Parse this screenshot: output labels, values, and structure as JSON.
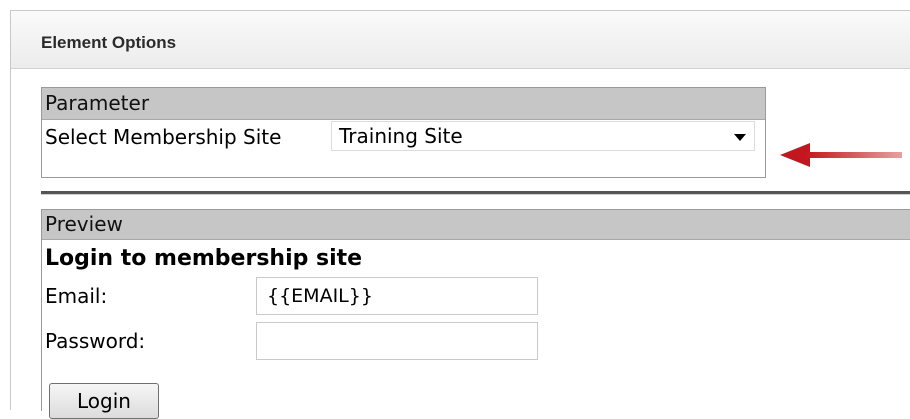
{
  "panel": {
    "title": "Element Options"
  },
  "parameter": {
    "header": "Parameter",
    "label": "Select Membership Site",
    "selected_value": "Training Site"
  },
  "preview": {
    "header": "Preview",
    "login_title": "Login to membership site",
    "email_label": "Email:",
    "email_value": "{{EMAIL}}",
    "password_label": "Password:",
    "password_value": "",
    "login_button": "Login"
  },
  "icons": {
    "dropdown": "chevron-down-icon",
    "annotation": "arrow-left-icon"
  },
  "colors": {
    "annotation_arrow": "#c0181e",
    "section_header": "#c6c6c6"
  }
}
